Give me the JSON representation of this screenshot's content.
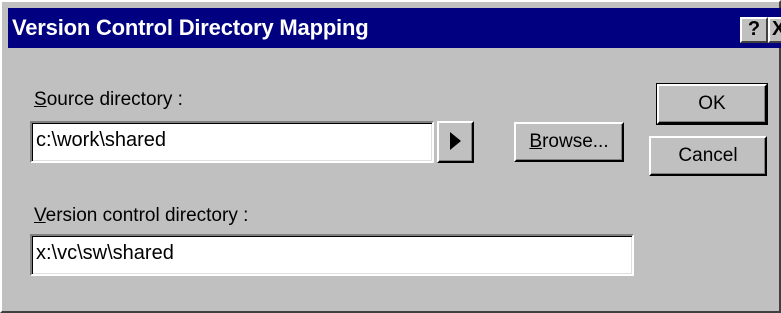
{
  "window": {
    "title": "Version Control Directory Mapping",
    "help_glyph": "?",
    "close_glyph": "X"
  },
  "source": {
    "label_accel": "S",
    "label_rest": "ource directory :",
    "value": "c:\\work\\shared"
  },
  "arrow_button": {
    "icon": "right-triangle-arrow"
  },
  "browse": {
    "label_accel": "B",
    "label_rest": "rowse..."
  },
  "vc": {
    "label_accel": "V",
    "label_rest": "ersion control directory :",
    "value": "x:\\vc\\sw\\shared"
  },
  "buttons": {
    "ok_label": "OK",
    "cancel_label": "Cancel"
  },
  "colors": {
    "title_bar": "#000080",
    "face": "#c0c0c0",
    "field": "#ffffff"
  }
}
